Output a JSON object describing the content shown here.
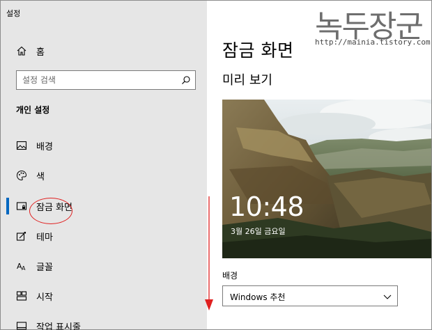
{
  "window": {
    "title": "설정"
  },
  "sidebar": {
    "home_label": "홈",
    "search_placeholder": "설정 검색",
    "section_title": "개인 설정",
    "items": [
      {
        "label": "배경",
        "icon": "picture-icon"
      },
      {
        "label": "색",
        "icon": "palette-icon"
      },
      {
        "label": "잠금 화면",
        "icon": "lock-screen-icon",
        "selected": true
      },
      {
        "label": "테마",
        "icon": "theme-icon"
      },
      {
        "label": "글꼴",
        "icon": "font-icon"
      },
      {
        "label": "시작",
        "icon": "start-icon"
      },
      {
        "label": "작업 표시줄",
        "icon": "taskbar-icon"
      }
    ]
  },
  "main": {
    "title": "잠금 화면",
    "preview_heading": "미리 보기",
    "preview_time": "10:48",
    "preview_date": "3월 26일 금요일",
    "background_label": "배경",
    "background_value": "Windows 추천"
  },
  "watermark": {
    "logo": "녹두장군",
    "url": "http://mainia.tistory.com"
  },
  "colors": {
    "accent": "#0067c0",
    "sidebar_bg": "#e6e6e6",
    "annotation": "#e02020"
  }
}
